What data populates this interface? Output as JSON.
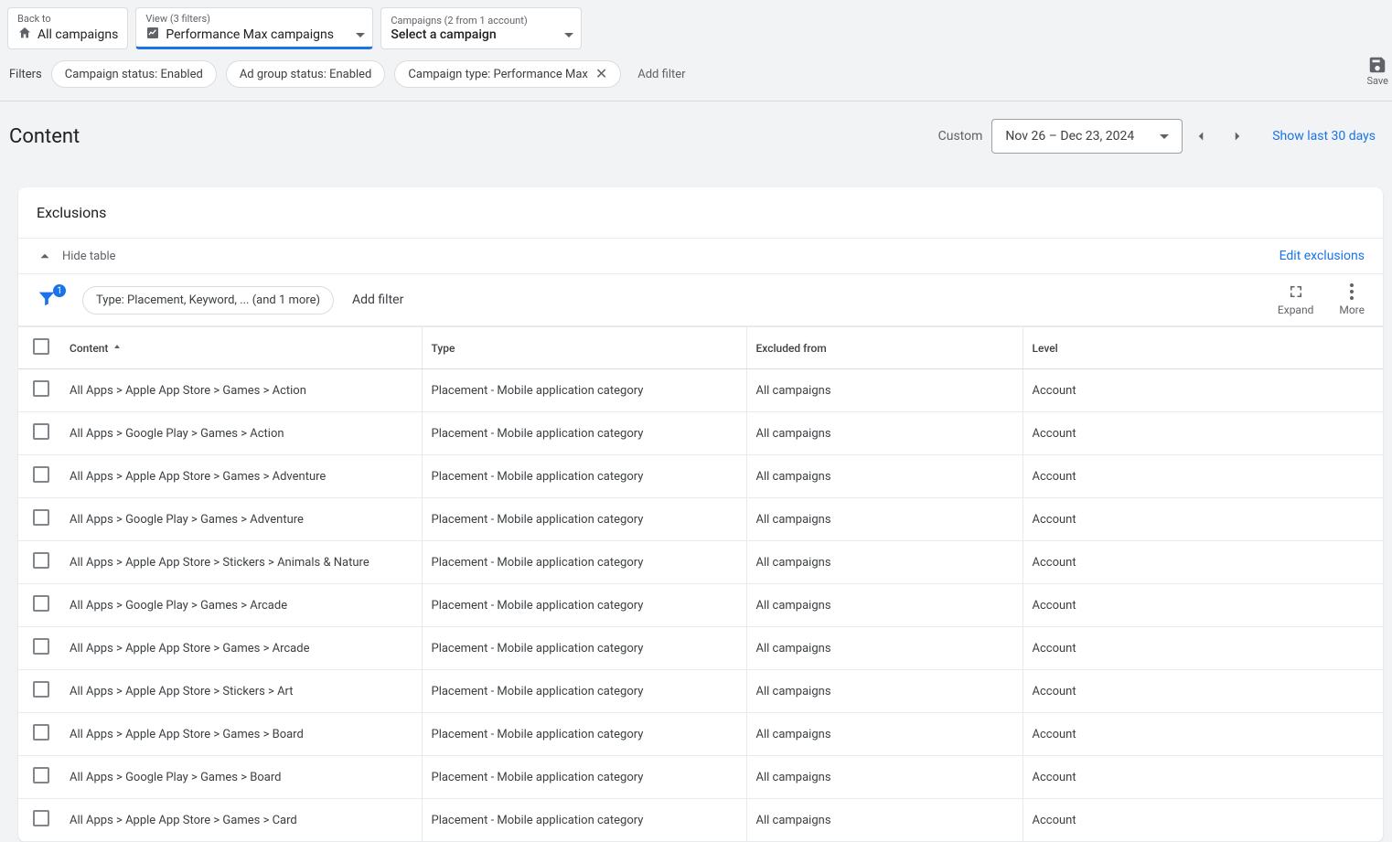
{
  "topnav": {
    "back": {
      "small": "Back to",
      "main": "All campaigns"
    },
    "view": {
      "small": "View (3 filters)",
      "main": "Performance Max campaigns"
    },
    "campaign": {
      "small": "Campaigns (2 from 1 account)",
      "main": "Select a campaign"
    }
  },
  "filters": {
    "label": "Filters",
    "chips": [
      {
        "label": "Campaign status: Enabled",
        "closable": false
      },
      {
        "label": "Ad group status: Enabled",
        "closable": false
      },
      {
        "label": "Campaign type: Performance Max",
        "closable": true
      }
    ],
    "add": "Add filter",
    "save": "Save"
  },
  "page": {
    "title": "Content",
    "range_mode": "Custom",
    "date_range": "Nov 26 – Dec 23, 2024",
    "show_last": "Show last 30 days"
  },
  "card": {
    "title": "Exclusions",
    "hide": "Hide table",
    "edit": "Edit exclusions"
  },
  "toolbar": {
    "filter_count": "1",
    "type_chip": "Type: Placement, Keyword, ... (and 1 more)",
    "add_filter": "Add filter",
    "expand": "Expand",
    "more": "More"
  },
  "table": {
    "columns": [
      "Content",
      "Type",
      "Excluded from",
      "Level"
    ],
    "rows": [
      {
        "content": "All Apps > Apple App Store > Games > Action",
        "type": "Placement - Mobile application category",
        "excluded": "All campaigns",
        "level": "Account"
      },
      {
        "content": "All Apps > Google Play > Games > Action",
        "type": "Placement - Mobile application category",
        "excluded": "All campaigns",
        "level": "Account"
      },
      {
        "content": "All Apps > Apple App Store > Games > Adventure",
        "type": "Placement - Mobile application category",
        "excluded": "All campaigns",
        "level": "Account"
      },
      {
        "content": "All Apps > Google Play > Games > Adventure",
        "type": "Placement - Mobile application category",
        "excluded": "All campaigns",
        "level": "Account"
      },
      {
        "content": "All Apps > Apple App Store > Stickers > Animals & Nature",
        "type": "Placement - Mobile application category",
        "excluded": "All campaigns",
        "level": "Account"
      },
      {
        "content": "All Apps > Google Play > Games > Arcade",
        "type": "Placement - Mobile application category",
        "excluded": "All campaigns",
        "level": "Account"
      },
      {
        "content": "All Apps > Apple App Store > Games > Arcade",
        "type": "Placement - Mobile application category",
        "excluded": "All campaigns",
        "level": "Account"
      },
      {
        "content": "All Apps > Apple App Store > Stickers > Art",
        "type": "Placement - Mobile application category",
        "excluded": "All campaigns",
        "level": "Account"
      },
      {
        "content": "All Apps > Apple App Store > Games > Board",
        "type": "Placement - Mobile application category",
        "excluded": "All campaigns",
        "level": "Account"
      },
      {
        "content": "All Apps > Google Play > Games > Board",
        "type": "Placement - Mobile application category",
        "excluded": "All campaigns",
        "level": "Account"
      },
      {
        "content": "All Apps > Apple App Store > Games > Card",
        "type": "Placement - Mobile application category",
        "excluded": "All campaigns",
        "level": "Account"
      }
    ]
  }
}
